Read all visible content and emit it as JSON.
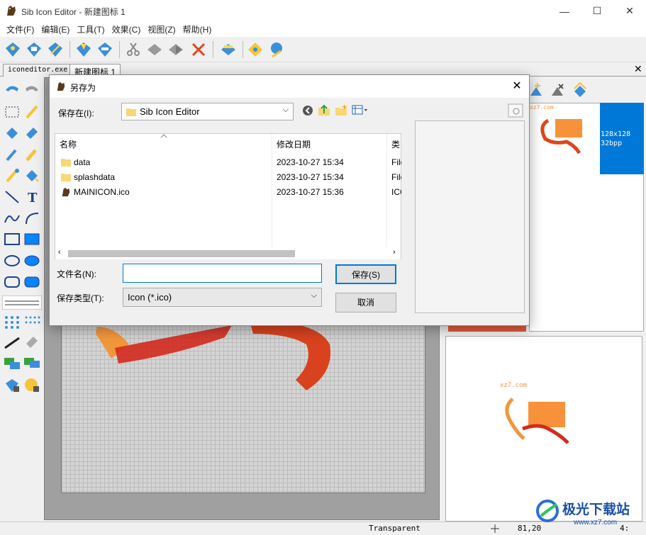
{
  "window": {
    "title": "Sib Icon Editor - 新建图标 1",
    "minimize": "—",
    "maximize": "☐",
    "close": "✕"
  },
  "menu": [
    "文件(F)",
    "编辑(E)",
    "工具(T)",
    "效果(C)",
    "视图(Z)",
    "帮助(H)"
  ],
  "tabs": [
    {
      "label": "iconeditor.exe"
    },
    {
      "label": "新建图标 1"
    }
  ],
  "tab_close": "✕",
  "preview": {
    "size_line1": "128x128",
    "size_line2": "32bpp",
    "small_text": "xz7.com",
    "big_text": "xz7.com"
  },
  "status": {
    "mode": "Transparent",
    "coords": "81,20",
    "zoom": "4:"
  },
  "dialog": {
    "title": "另存为",
    "save_in_label": "保存在(I):",
    "save_in_value": "Sib Icon Editor",
    "columns": [
      "名称",
      "修改日期",
      "类"
    ],
    "files": [
      {
        "name": "data",
        "date": "2023-10-27 15:34",
        "type": "File",
        "icon": "folder-icon"
      },
      {
        "name": "splashdata",
        "date": "2023-10-27 15:34",
        "type": "File",
        "icon": "folder-icon"
      },
      {
        "name": "MAINICON.ico",
        "date": "2023-10-27 15:36",
        "type": "ICO",
        "icon": "ico-file-icon"
      }
    ],
    "filename_label": "文件名(N):",
    "filename_value": "",
    "filetype_label": "保存类型(T):",
    "filetype_value": "Icon (*.ico)",
    "save_button": "保存(S)",
    "cancel_button": "取消"
  },
  "watermark": {
    "text": "极光下载站",
    "url": "www.xz7.com"
  },
  "colors": {
    "accent": "#0078d7",
    "orange": "#f7923a",
    "red": "#d42a1e"
  }
}
